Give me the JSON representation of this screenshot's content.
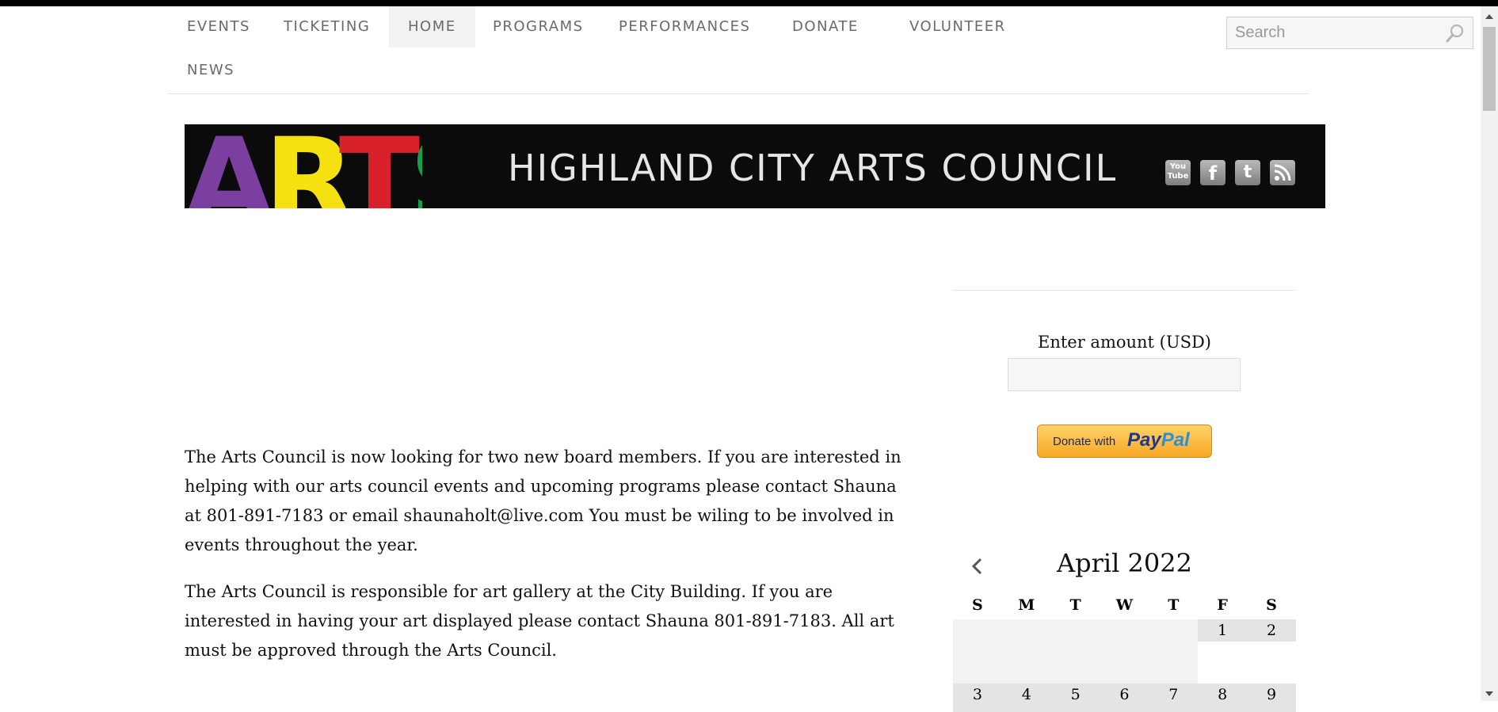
{
  "nav": {
    "items": [
      "EVENTS",
      "TICKETING",
      "HOME",
      "PROGRAMS",
      "PERFORMANCES",
      "DONATE",
      "VOLUNTEER",
      "NEWS"
    ],
    "active": "HOME"
  },
  "search": {
    "placeholder": "Search"
  },
  "banner": {
    "logo_text": "ARTS",
    "logo_colors": [
      "#7b3fa0",
      "#f5e10f",
      "#d8202a",
      "#17a04a"
    ],
    "title": "HIGHLAND CITY ARTS COUNCIL",
    "social": {
      "youtube_line1": "You",
      "youtube_line2": "Tube",
      "facebook": "f",
      "twitter": "t",
      "icons": [
        "youtube-icon",
        "facebook-icon",
        "twitter-icon",
        "rss-icon"
      ]
    }
  },
  "content": {
    "paragraphs": [
      "The Arts Council is now looking for two new board members.  If you are interested in helping with our arts council events and upcoming programs please contact Shauna at 801-891-7183 or email shaunaholt@live.com  You must be wiling to be involved in events throughout the year.",
      "The Arts Council is responsible for art gallery at the City Building.  If you are interested in having your art displayed please contact Shauna 801-891-7183.  All art must be approved through the Arts Council."
    ]
  },
  "donate": {
    "label": "Enter amount (USD)",
    "amount": "",
    "paypal_prefix": "Donate with",
    "paypal_pay": "Pay",
    "paypal_pal": "Pal",
    "colors": {
      "paypal_gold": "#f7a823",
      "paypal_dark": "#1d3a86",
      "paypal_light": "#2f8fd3"
    }
  },
  "calendar": {
    "title": "April 2022",
    "weekdays": [
      "S",
      "M",
      "T",
      "W",
      "T",
      "F",
      "S"
    ],
    "week1": [
      "",
      "",
      "",
      "",
      "",
      "1",
      "2"
    ],
    "week2": [
      "3",
      "4",
      "5",
      "6",
      "7",
      "8",
      "9"
    ]
  }
}
